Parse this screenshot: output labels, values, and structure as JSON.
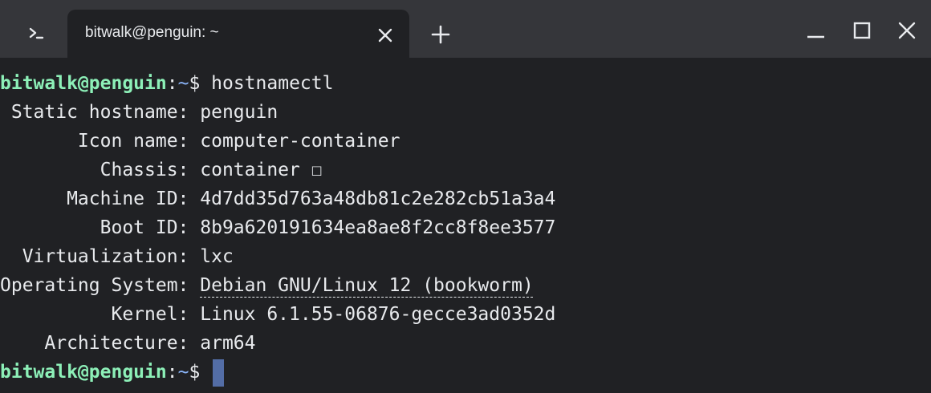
{
  "window": {
    "tab_title": "bitwalk@penguin: ~",
    "icons": {
      "app": "terminal-prompt-icon",
      "tab_close": "close-icon",
      "new_tab": "plus-icon",
      "minimize": "minimize-icon",
      "maximize": "maximize-icon",
      "close": "close-icon"
    }
  },
  "terminal": {
    "prompt": {
      "user_host": "bitwalk@penguin",
      "colon": ":",
      "path": "~",
      "dollar": "$ "
    },
    "command": "hostnamectl",
    "rows": [
      {
        "label": " Static hostname: ",
        "value": "penguin"
      },
      {
        "label": "       Icon name: ",
        "value": "computer-container"
      },
      {
        "label": "         Chassis: ",
        "value": "container ☐"
      },
      {
        "label": "      Machine ID: ",
        "value": "4d7dd35d763a48db81c2e282cb51a3a4"
      },
      {
        "label": "         Boot ID: ",
        "value": "8b9a620191634ea8ae8f2cc8f8ee3577"
      },
      {
        "label": "  Virtualization: ",
        "value": "lxc"
      },
      {
        "label": "Operating System: ",
        "value": "Debian GNU/Linux 12 (bookworm)"
      },
      {
        "label": "          Kernel: ",
        "value": "Linux 6.1.55-06876-gecce3ad0352d"
      },
      {
        "label": "    Architecture: ",
        "value": "arm64"
      }
    ]
  },
  "colors": {
    "background": "#202124",
    "titlebar": "#35363a",
    "text": "#e8eaed",
    "user": "#8df0b8",
    "path": "#8ab4f8",
    "cursor": "#536da6"
  }
}
